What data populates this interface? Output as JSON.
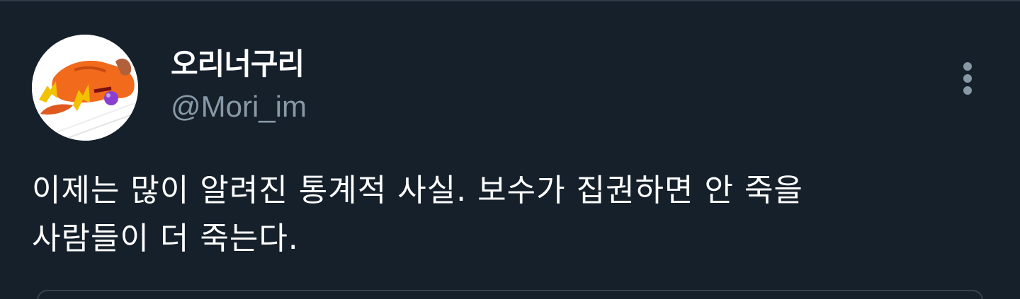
{
  "tweet": {
    "author": {
      "display_name": "오리너구리",
      "handle": "@Mori_im",
      "avatar_icon": "duck-cartoon-avatar"
    },
    "more_icon": "more-vertical-icon",
    "text_lines": [
      "이제는 많이 알려진 통계적 사실. 보수가 집권하면 안 죽을",
      "사람들이 더 죽는다."
    ]
  },
  "colors": {
    "background": "#15202b",
    "primary_text": "#ffffff",
    "secondary_text": "#8899a6",
    "border": "#38444d"
  }
}
